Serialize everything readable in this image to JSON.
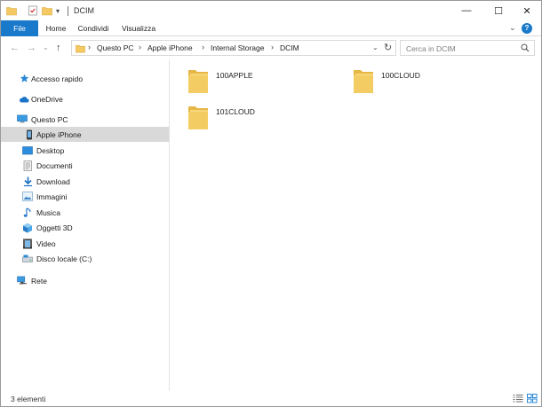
{
  "window": {
    "title": "DCIM"
  },
  "titlebar": {
    "customize_glyph": "▾",
    "minimize_glyph": "—",
    "maximize_glyph": "☐",
    "close_glyph": "✕"
  },
  "ribbon": {
    "tabs": [
      {
        "label": "File"
      },
      {
        "label": "Home"
      },
      {
        "label": "Condividi"
      },
      {
        "label": "Visualizza"
      }
    ],
    "expand_glyph": "⌄",
    "help_glyph": "?",
    "file_color": "#1979ca"
  },
  "nav": {
    "back_glyph": "←",
    "forward_glyph": "→",
    "recent_glyph": "⌄",
    "up_glyph": "↑"
  },
  "address": {
    "breadcrumb": [
      "Questo PC",
      "Apple iPhone",
      "Internal Storage",
      "DCIM"
    ],
    "separator": "›",
    "dropdown_glyph": "⌄",
    "refresh_glyph": "↻"
  },
  "search": {
    "placeholder": "Cerca in DCIM"
  },
  "sidebar": {
    "items": [
      {
        "label": "Accesso rapido",
        "icon": "star-icon"
      },
      {
        "label": "OneDrive",
        "icon": "cloud-icon"
      },
      {
        "label": "Questo PC",
        "icon": "computer-icon"
      },
      {
        "label": "Apple iPhone",
        "icon": "phone-icon",
        "selected": true
      },
      {
        "label": "Desktop",
        "icon": "desktop-icon"
      },
      {
        "label": "Documenti",
        "icon": "documents-icon"
      },
      {
        "label": "Download",
        "icon": "download-icon"
      },
      {
        "label": "Immagini",
        "icon": "pictures-icon"
      },
      {
        "label": "Musica",
        "icon": "music-icon"
      },
      {
        "label": "Oggetti 3D",
        "icon": "cube-icon"
      },
      {
        "label": "Video",
        "icon": "video-icon"
      },
      {
        "label": "Disco locale (C:)",
        "icon": "drive-icon"
      },
      {
        "label": "Rete",
        "icon": "network-icon"
      }
    ]
  },
  "content": {
    "folders": [
      {
        "name": "100APPLE"
      },
      {
        "name": "100CLOUD"
      },
      {
        "name": "101CLOUD"
      }
    ]
  },
  "status": {
    "text": "3 elementi"
  }
}
